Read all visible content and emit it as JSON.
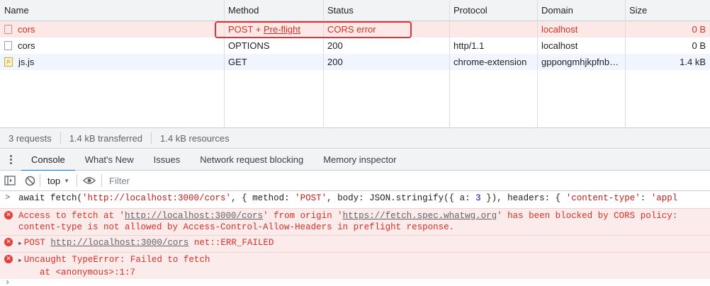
{
  "network": {
    "columns": [
      "Name",
      "Method",
      "Status",
      "Protocol",
      "Domain",
      "Size"
    ],
    "rows": [
      {
        "name": "cors",
        "method_prefix": "POST + ",
        "method_link": "Pre-flight",
        "status": "CORS error",
        "protocol": "",
        "domain": "localhost",
        "size": "0 B",
        "state": "error"
      },
      {
        "name": "cors",
        "method": "OPTIONS",
        "status": "200",
        "protocol": "http/1.1",
        "domain": "localhost",
        "size": "0 B"
      },
      {
        "name": "js.js",
        "method": "GET",
        "status": "200",
        "protocol": "chrome-extension",
        "domain": "gppongmhjkpfnb…",
        "size": "1.4 kB",
        "icon": "js-file-icon"
      }
    ]
  },
  "summary": {
    "requests": "3 requests",
    "transferred": "1.4 kB transferred",
    "resources": "1.4 kB resources"
  },
  "drawer": {
    "tabs": [
      "Console",
      "What's New",
      "Issues",
      "Network request blocking",
      "Memory inspector"
    ],
    "active_tab": "Console"
  },
  "console_toolbar": {
    "context": "top",
    "filter_placeholder": "Filter"
  },
  "console": {
    "input": {
      "t1": "await fetch(",
      "s1": "'http://localhost:3000/cors'",
      "t2": ", { method: ",
      "s2": "'POST'",
      "t3": ", body: JSON.stringify({ a: ",
      "n1": "3",
      "t4": " }), headers: { ",
      "s3": "'content-type'",
      "t5": ": ",
      "s4": "'appl"
    },
    "error1": {
      "p1": "Access to fetch at '",
      "url": "http://localhost:3000/cors",
      "p2": "' from origin '",
      "origin": "https://fetch.spec.whatwg.org",
      "p3": "' has been blocked by CORS policy:",
      "line2": "content-type is not allowed by Access-Control-Allow-Headers in preflight response."
    },
    "error2": {
      "method": "POST ",
      "url": "http://localhost:3000/cors",
      "suffix": " net::ERR_FAILED"
    },
    "error3": {
      "line1": "Uncaught TypeError: Failed to fetch",
      "line2": "    at <anonymous>:1:7"
    }
  },
  "colors": {
    "error_text": "#d93025",
    "error_bg": "#fce8e6",
    "highlight_border": "#e0323a",
    "accent": "#1a73e8"
  }
}
